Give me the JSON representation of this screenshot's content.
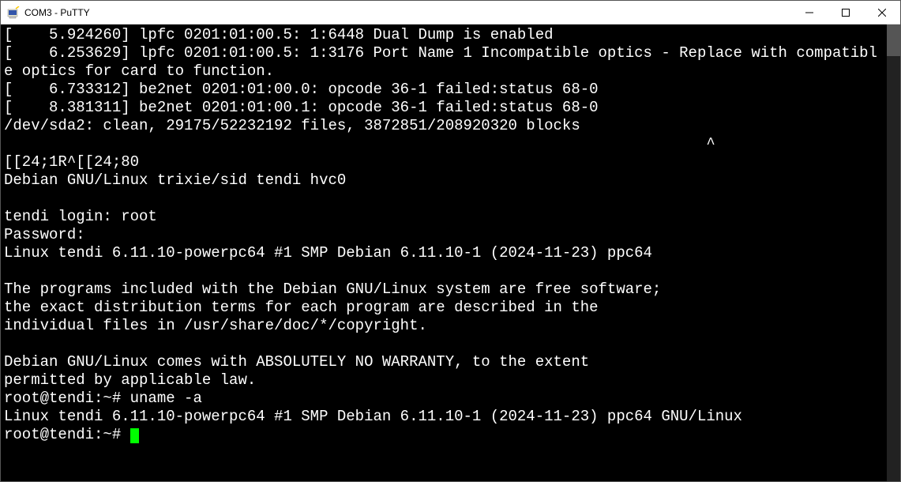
{
  "window": {
    "title": "COM3 - PuTTY"
  },
  "terminal": {
    "lines": [
      "[    5.924260] lpfc 0201:01:00.5: 1:6448 Dual Dump is enabled",
      "[    6.253629] lpfc 0201:01:00.5: 1:3176 Port Name 1 Incompatible optics - Replace with compatible optics for card to function.",
      "[    6.733312] be2net 0201:01:00.0: opcode 36-1 failed:status 68-0",
      "[    8.381311] be2net 0201:01:00.1: opcode 36-1 failed:status 68-0",
      "/dev/sda2: clean, 29175/52232192 files, 3872851/208920320 blocks",
      "                                                                              ^",
      "[[24;1R^[[24;80",
      "Debian GNU/Linux trixie/sid tendi hvc0",
      "",
      "tendi login: root",
      "Password:",
      "Linux tendi 6.11.10-powerpc64 #1 SMP Debian 6.11.10-1 (2024-11-23) ppc64",
      "",
      "The programs included with the Debian GNU/Linux system are free software;",
      "the exact distribution terms for each program are described in the",
      "individual files in /usr/share/doc/*/copyright.",
      "",
      "Debian GNU/Linux comes with ABSOLUTELY NO WARRANTY, to the extent",
      "permitted by applicable law.",
      "root@tendi:~# uname -a",
      "Linux tendi 6.11.10-powerpc64 #1 SMP Debian 6.11.10-1 (2024-11-23) ppc64 GNU/Linux",
      "root@tendi:~# "
    ]
  }
}
